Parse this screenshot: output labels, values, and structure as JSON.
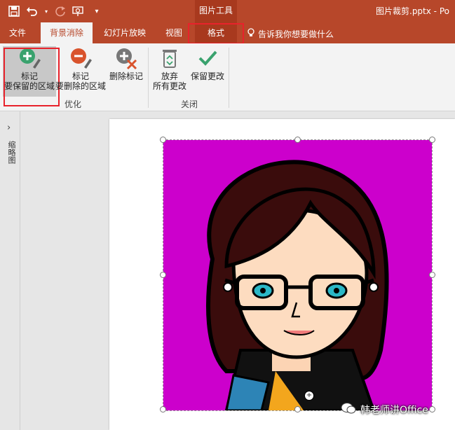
{
  "titlebar": {
    "context_group": "图片工具",
    "doc_title": "图片裁剪.pptx  -  Po"
  },
  "tabs": {
    "file": "文件",
    "bg_removal": "背景消除",
    "slideshow": "幻灯片放映",
    "view": "视图",
    "format": "格式"
  },
  "tell_me": "告诉我你想要做什么",
  "ribbon": {
    "mark_keep": [
      "标记",
      "要保留的区域"
    ],
    "mark_remove": [
      "标记",
      "要删除的区域"
    ],
    "delete_mark": "删除标记",
    "discard": [
      "放弃",
      "所有更改"
    ],
    "keep_changes": "保留更改",
    "group_optimize": "优化",
    "group_close": "关闭"
  },
  "left_pane": {
    "label": "缩略图"
  },
  "watermark": "韩老师讲Office",
  "colors": {
    "accent": "#b7472a",
    "highlight": "#e8222b",
    "picture_bg": "#cc00cc"
  }
}
